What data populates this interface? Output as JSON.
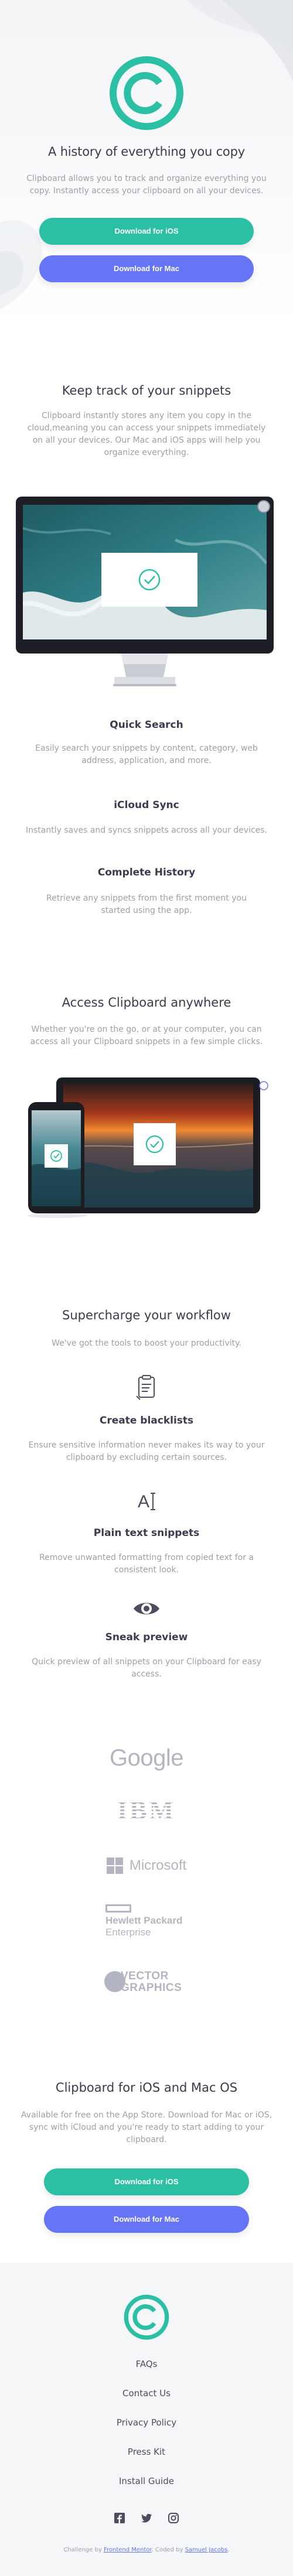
{
  "colors": {
    "teal": "#2bc0a4",
    "blue": "#6575f5",
    "heading": "#3a3b4f",
    "muted": "#9da0ab",
    "footer_bg": "#f5f6f8"
  },
  "hero": {
    "logo_icon": "copyright-logo-icon",
    "title": "A history of everything you copy",
    "text": "Clipboard allows you to track and organize everything you copy. Instantly access your clipboard on all your devices.",
    "btn_ios": "Download for iOS",
    "btn_mac": "Download for Mac"
  },
  "snippets": {
    "title": "Keep track of your snippets",
    "text": "Clipboard instantly stores any item you copy in the cloud,meaning you can access your snippets immediately on all your devices. Our Mac and iOS apps will help you organize everything."
  },
  "features": [
    {
      "title": "Quick Search",
      "text": "Easily search your snippets by content, category, web address, application, and more."
    },
    {
      "title": "iCloud Sync",
      "text": "Instantly saves and syncs snippets across all your devices."
    },
    {
      "title": "Complete History",
      "text": "Retrieve any snippets from the first moment you started using the app."
    }
  ],
  "access": {
    "title": "Access Clipboard anywhere",
    "text": "Whether you're on the go, or at your computer, you can access all your Clipboard snippets in a few simple clicks."
  },
  "workflow": {
    "title": "Supercharge your workflow",
    "text": "We've got the tools to boost your productivity.",
    "items": [
      {
        "icon": "blacklist-icon",
        "title": "Create blacklists",
        "text": "Ensure sensitive information never makes its way to your clipboard by excluding certain sources."
      },
      {
        "icon": "text-cursor-icon",
        "title": "Plain text snippets",
        "text": "Remove unwanted formatting from copied text for a consistent look."
      },
      {
        "icon": "eye-icon",
        "title": "Sneak preview",
        "text": "Quick preview of all snippets on your Clipboard for easy access."
      }
    ]
  },
  "brands": {
    "google": "Google",
    "ibm": "IBM",
    "microsoft": "Microsoft",
    "hp_line1": "Hewlett Packard",
    "hp_line2": "Enterprise",
    "vector_line1": "VECTOR",
    "vector_line2": "GRAPHICS"
  },
  "cta": {
    "title": "Clipboard for iOS and Mac OS",
    "text": "Available for free on the App Store. Download for Mac or iOS, sync with iCloud and you're ready to start adding to your clipboard.",
    "btn_ios": "Download for iOS",
    "btn_mac": "Download for Mac"
  },
  "footer": {
    "links": [
      "FAQs",
      "Contact Us",
      "Privacy Policy",
      "Press Kit",
      "Install Guide"
    ],
    "social": [
      "facebook-icon",
      "twitter-icon",
      "instagram-icon"
    ],
    "credit_prefix": "Challenge by",
    "credit_fm": "Frontend Mentor",
    "credit_mid": ". Coded by",
    "credit_author": "Samuel Jacobs",
    "credit_suffix": "."
  }
}
